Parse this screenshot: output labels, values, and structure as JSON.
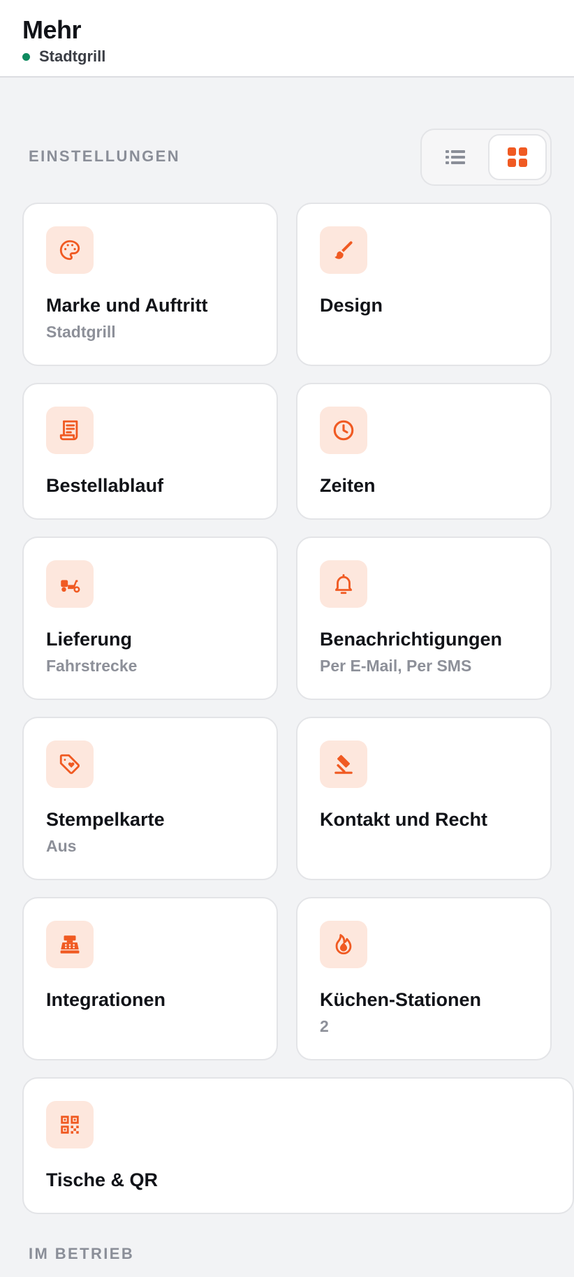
{
  "header": {
    "title": "Mehr",
    "store_name": "Stadtgrill",
    "status_color": "#0e8a5f"
  },
  "colors": {
    "accent": "#f05a22",
    "icon_bg": "#fde7dd"
  },
  "settings_section": {
    "label": "EINSTELLUNGEN",
    "view_toggle": {
      "options": [
        {
          "icon": "list-view-icon",
          "selected": false
        },
        {
          "icon": "grid-view-icon",
          "selected": true
        }
      ]
    },
    "cards": [
      {
        "icon": "palette-icon",
        "title": "Marke und Auftritt",
        "subtitle": "Stadtgrill"
      },
      {
        "icon": "paintbrush-icon",
        "title": "Design",
        "subtitle": ""
      },
      {
        "icon": "receipt-icon",
        "title": "Bestellablauf",
        "subtitle": ""
      },
      {
        "icon": "clock-icon",
        "title": "Zeiten",
        "subtitle": ""
      },
      {
        "icon": "scooter-icon",
        "title": "Lieferung",
        "subtitle": "Fahrstrecke"
      },
      {
        "icon": "bell-icon",
        "title": "Benachrichtigungen",
        "subtitle": "Per E-Mail, Per SMS"
      },
      {
        "icon": "tag-heart-icon",
        "title": "Stempelkarte",
        "subtitle": "Aus"
      },
      {
        "icon": "gavel-icon",
        "title": "Kontakt und Recht",
        "subtitle": ""
      },
      {
        "icon": "cash-register-icon",
        "title": "Integrationen",
        "subtitle": ""
      },
      {
        "icon": "fire-icon",
        "title": "Küchen-Stationen",
        "subtitle": "2"
      },
      {
        "icon": "qr-code-icon",
        "title": "Tische & QR",
        "subtitle": ""
      }
    ]
  },
  "operations_section": {
    "label": "IM BETRIEB"
  }
}
